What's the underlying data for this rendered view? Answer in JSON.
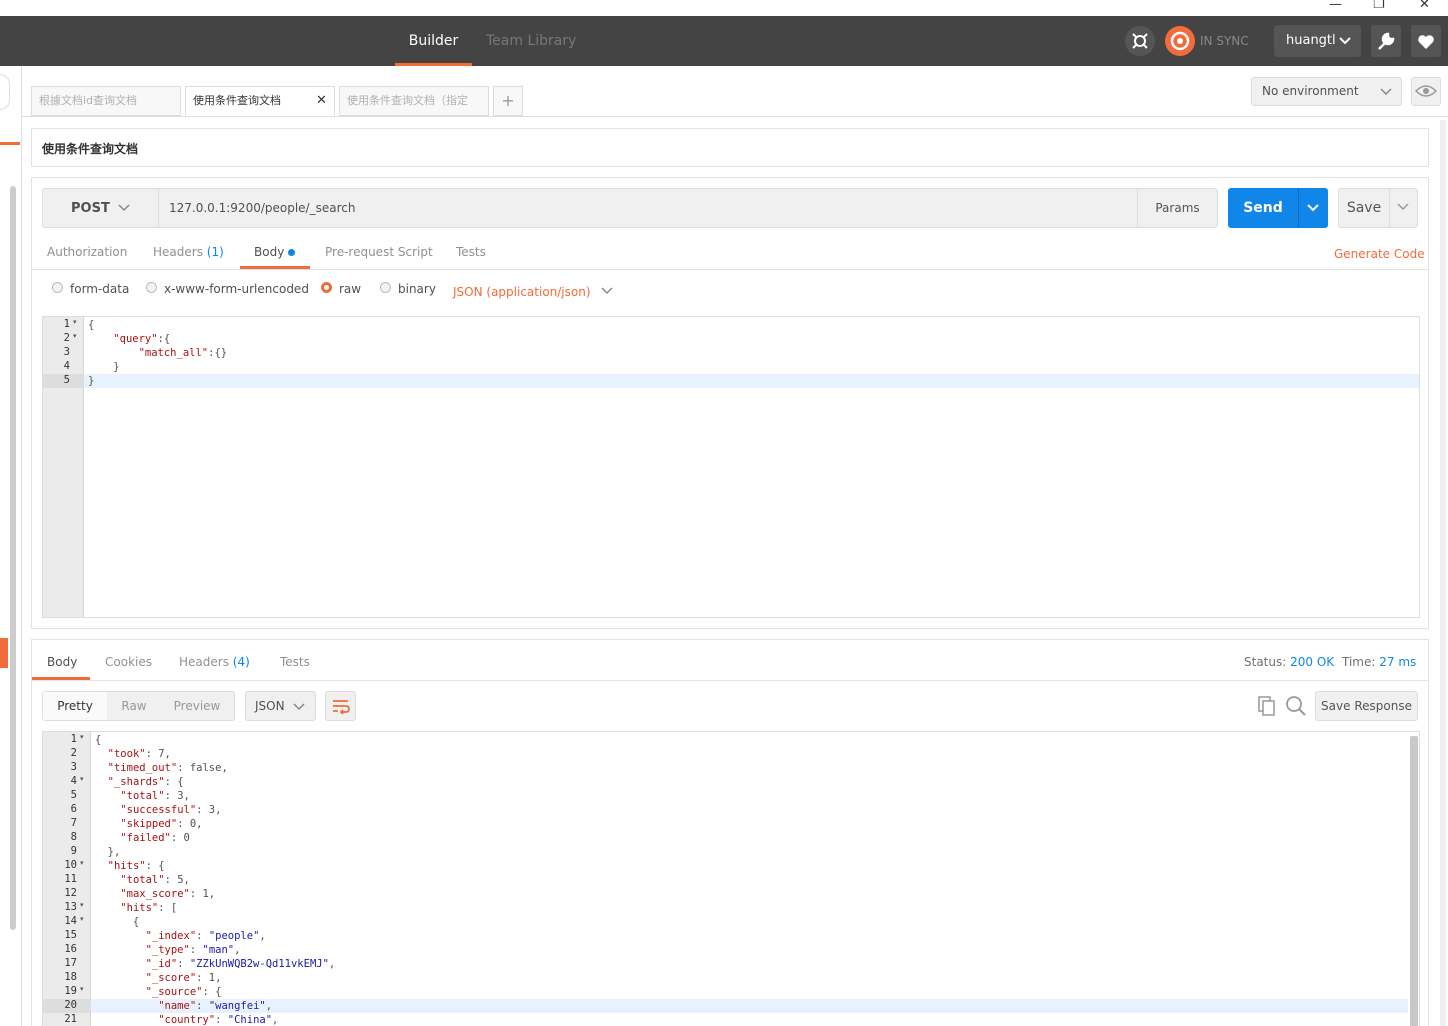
{
  "header": {
    "builder_tab": "Builder",
    "team_library_tab": "Team Library",
    "sync_status": "IN SYNC",
    "user_name": "huangtl",
    "accent_color": "#f26b3a"
  },
  "tabs": [
    {
      "label": "根據文档id查询文档"
    },
    {
      "label": "使用条件查询文档"
    },
    {
      "label": "使用条件查询文档（指定"
    }
  ],
  "environment": {
    "selected": "No environment"
  },
  "request": {
    "name": "使用条件查询文档",
    "method": "POST",
    "url": "127.0.0.1:9200/people/_search",
    "params_label": "Params",
    "send_label": "Send",
    "save_label": "Save"
  },
  "request_tabs": {
    "authorization": "Authorization",
    "headers": "Headers",
    "headers_count": "(1)",
    "body": "Body",
    "pre_request": "Pre-request Script",
    "tests": "Tests",
    "generate_code": "Generate Code"
  },
  "body_modes": {
    "form_data": "form-data",
    "urlencoded": "x-www-form-urlencoded",
    "raw": "raw",
    "binary": "binary",
    "content_type": "JSON (application/json)"
  },
  "request_body_lines": [
    {
      "no": "1",
      "text": "{"
    },
    {
      "no": "2",
      "text": "    \"query\":{"
    },
    {
      "no": "3",
      "text": "        \"match_all\":{}"
    },
    {
      "no": "4",
      "text": "    }"
    },
    {
      "no": "5",
      "text": "}"
    }
  ],
  "response_tabs": {
    "body": "Body",
    "cookies": "Cookies",
    "headers": "Headers",
    "headers_count": "(4)",
    "tests": "Tests",
    "status_label": "Status:",
    "status_value": "200 OK",
    "time_label": "Time:",
    "time_value": "27 ms"
  },
  "response_view": {
    "pretty": "Pretty",
    "raw": "Raw",
    "preview": "Preview",
    "format": "JSON",
    "save_response": "Save Response"
  },
  "response_body_lines": [
    {
      "no": "1",
      "text": "{"
    },
    {
      "no": "2",
      "text": "  \"took\": 7,"
    },
    {
      "no": "3",
      "text": "  \"timed_out\": false,"
    },
    {
      "no": "4",
      "text": "  \"_shards\": {"
    },
    {
      "no": "5",
      "text": "    \"total\": 3,"
    },
    {
      "no": "6",
      "text": "    \"successful\": 3,"
    },
    {
      "no": "7",
      "text": "    \"skipped\": 0,"
    },
    {
      "no": "8",
      "text": "    \"failed\": 0"
    },
    {
      "no": "9",
      "text": "  },"
    },
    {
      "no": "10",
      "text": "  \"hits\": {"
    },
    {
      "no": "11",
      "text": "    \"total\": 5,"
    },
    {
      "no": "12",
      "text": "    \"max_score\": 1,"
    },
    {
      "no": "13",
      "text": "    \"hits\": ["
    },
    {
      "no": "14",
      "text": "      {"
    },
    {
      "no": "15",
      "text": "        \"_index\": \"people\","
    },
    {
      "no": "16",
      "text": "        \"_type\": \"man\","
    },
    {
      "no": "17",
      "text": "        \"_id\": \"ZZkUnWQB2w-Qd11vkEMJ\","
    },
    {
      "no": "18",
      "text": "        \"_score\": 1,"
    },
    {
      "no": "19",
      "text": "        \"_source\": {"
    },
    {
      "no": "20",
      "text": "          \"name\": \"wangfei\","
    },
    {
      "no": "21",
      "text": "          \"country\": \"China\","
    }
  ]
}
